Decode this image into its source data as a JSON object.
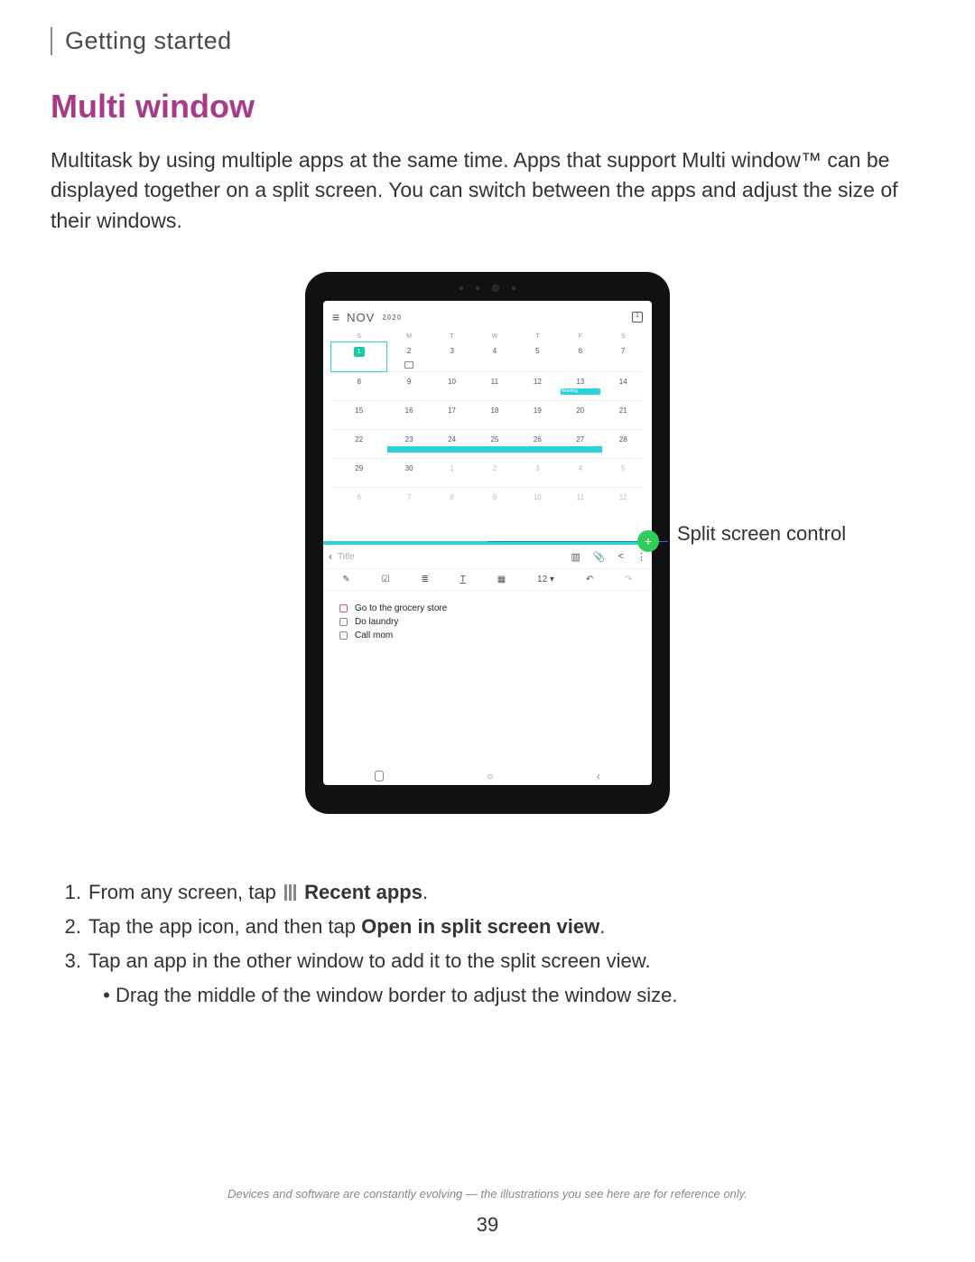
{
  "section": "Getting started",
  "heading": "Multi window",
  "intro": "Multitask by using multiple apps at the same time. Apps that support Multi window™ can be displayed together on a split screen. You can switch between the apps and adjust the size of their windows.",
  "callout": "Split screen control",
  "calendar": {
    "month": "NOV",
    "year": "2020",
    "dow": [
      "S",
      "M",
      "T",
      "W",
      "T",
      "F",
      "S"
    ],
    "week1": [
      "1",
      "2",
      "3",
      "4",
      "5",
      "6",
      "7"
    ],
    "week2": [
      "8",
      "9",
      "10",
      "11",
      "12",
      "13",
      "14"
    ],
    "meeting_label": "Meeting",
    "week3": [
      "15",
      "16",
      "17",
      "18",
      "19",
      "20",
      "21"
    ],
    "week4": [
      "22",
      "23",
      "24",
      "25",
      "26",
      "27",
      "28"
    ],
    "week5": [
      "29",
      "30",
      "1",
      "2",
      "3",
      "4",
      "5"
    ],
    "week6": [
      "6",
      "7",
      "8",
      "9",
      "10",
      "11",
      "12"
    ]
  },
  "notes": {
    "title_placeholder": "Title",
    "size": "12",
    "tasks": [
      "Go to the grocery store",
      "Do laundry",
      "Call mom"
    ]
  },
  "steps": {
    "s1a": "From any screen, tap",
    "s1b": "Recent apps",
    "s2a": "Tap the app icon, and then tap ",
    "s2b": "Open in split screen view",
    "s3": "Tap an app in the other window to add it to the split screen view.",
    "s3bullet": "Drag the middle of the window border to adjust the window size."
  },
  "footnote": "Devices and software are constantly evolving — the illustrations you see here are for reference only.",
  "page_number": "39"
}
